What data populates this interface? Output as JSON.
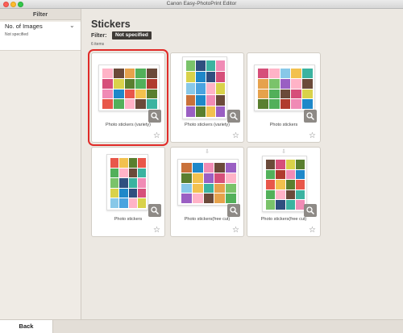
{
  "window": {
    "title": "Canon Easy-PhotoPrint Editor"
  },
  "sidebar": {
    "header": "Filter",
    "items": [
      {
        "label": "No. of Images",
        "value": "Not specified"
      }
    ]
  },
  "main": {
    "title": "Stickers",
    "filter_label": "Filter:",
    "filter_value": "Not specified",
    "items_count": "6 items",
    "cards": [
      {
        "label": "Photo stickers (variety)",
        "selected": true
      },
      {
        "label": "Photo stickers (variety)",
        "selected": false
      },
      {
        "label": "Photo stickers",
        "selected": false
      },
      {
        "label": "Photo stickers",
        "selected": false
      },
      {
        "label": "Photo stickers(free cut)",
        "selected": false
      },
      {
        "label": "Photo stickers(free cut)",
        "selected": false
      }
    ]
  },
  "footer": {
    "back_label": "Back"
  },
  "icons": {
    "zoom": "magnifier-icon",
    "favorite": "star-outline-icon",
    "download": "download-cloud-icon",
    "filter_toggle": "chevron-down-icon"
  },
  "colors": {
    "selection": "#e02b28",
    "badge": "#3e3a36",
    "background": "#ece8e2"
  }
}
